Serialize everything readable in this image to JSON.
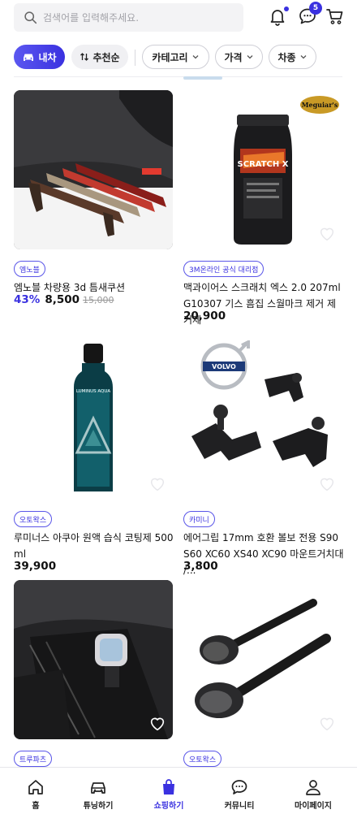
{
  "search": {
    "placeholder": "검색어를 입력해주세요."
  },
  "header": {
    "chat_badge": "5"
  },
  "filters": {
    "car_chip": "내차",
    "sort_chip": "추천순",
    "category": "카테고리",
    "price": "가격",
    "car_type": "차종"
  },
  "products": [
    {
      "brand": "엠노블",
      "name": "엠노블 차량용 3d 틈새쿠션",
      "discount": "43%",
      "price": "8,500",
      "original": "15,000"
    },
    {
      "brand": "3M온라인 공식 대리점",
      "name": "맥과이어스 스크래치 엑스 2.0 207ml G10307 기스 흠집 스월마크 제거 제거제",
      "discount": "",
      "price": "20,900",
      "original": ""
    },
    {
      "brand": "오토왁스",
      "name": "루미너스 아쿠아 원액 습식 코팅제 500ml",
      "discount": "",
      "price": "39,900",
      "original": ""
    },
    {
      "brand": "카미니",
      "name": "에어그립 17mm 호환 볼보 전용 S90 S60 XC60 XS40 XC90 마운트거치대 /...",
      "discount": "",
      "price": "3,800",
      "original": ""
    },
    {
      "brand": "트루파츠",
      "name": "",
      "discount": "",
      "price": "",
      "original": ""
    },
    {
      "brand": "오토왁스",
      "name": "",
      "discount": "",
      "price": "",
      "original": ""
    }
  ],
  "product_images": {
    "p1": {
      "logo": ""
    },
    "p2": {
      "logo": "Meguiar's",
      "label": "SCRATCH X"
    },
    "p3": {
      "label": "LUMINUS AQUA"
    },
    "p4": {
      "logo": "VOLVO"
    }
  },
  "nav": {
    "tabs": [
      {
        "label": "홈",
        "icon": "home-icon"
      },
      {
        "label": "튜닝하기",
        "icon": "car-icon"
      },
      {
        "label": "쇼핑하기",
        "icon": "shopping-bag-icon",
        "active": true
      },
      {
        "label": "커뮤니티",
        "icon": "chat-bubble-icon"
      },
      {
        "label": "마이페이지",
        "icon": "person-icon"
      }
    ]
  },
  "colors": {
    "accent": "#3a31e0",
    "chip_gray": "#f0f0f3",
    "border": "#cfcfd6"
  }
}
